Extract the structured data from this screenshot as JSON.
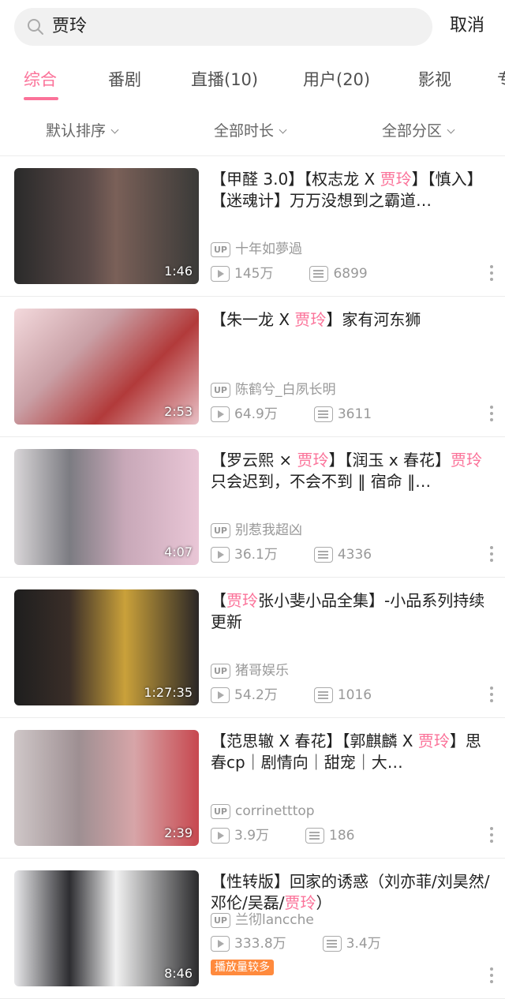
{
  "search": {
    "query": "贾玲",
    "cancel_label": "取消"
  },
  "tabs": [
    {
      "label": "综合",
      "active": true
    },
    {
      "label": "番剧"
    },
    {
      "label": "直播(10)"
    },
    {
      "label": "用户(20)"
    },
    {
      "label": "影视"
    },
    {
      "label": "专"
    }
  ],
  "filters": [
    {
      "label": "默认排序"
    },
    {
      "label": "全部时长"
    },
    {
      "label": "全部分区"
    }
  ],
  "colors": {
    "accent": "#fb7299",
    "hot_badge": "#ff8a3d"
  },
  "videos": [
    {
      "title_parts": [
        {
          "text": "【甲醛 3.0】【权志龙 X "
        },
        {
          "text": "贾玲",
          "hl": true
        },
        {
          "text": "】【慎入】【迷魂计】万万没想到之霸道…"
        }
      ],
      "duration": "1:46",
      "uploader": "十年如夢過",
      "views": "145万",
      "danmaku": "6899"
    },
    {
      "title_parts": [
        {
          "text": "【朱一龙 X "
        },
        {
          "text": "贾玲",
          "hl": true
        },
        {
          "text": "】家有河东狮"
        }
      ],
      "duration": "2:53",
      "uploader": "陈鹤兮_白夙长明",
      "views": "64.9万",
      "danmaku": "3611"
    },
    {
      "title_parts": [
        {
          "text": "【罗云熙 × "
        },
        {
          "text": "贾玲",
          "hl": true
        },
        {
          "text": "】【润玉 x 春花】"
        },
        {
          "text": "贾玲",
          "hl": true
        },
        {
          "text": "只会迟到，不会不到 ‖ 宿命 ‖…"
        }
      ],
      "duration": "4:07",
      "uploader": "别惹我超凶",
      "views": "36.1万",
      "danmaku": "4336"
    },
    {
      "title_parts": [
        {
          "text": "【"
        },
        {
          "text": "贾玲",
          "hl": true
        },
        {
          "text": "张小斐小品全集】-小品系列持续更新"
        }
      ],
      "duration": "1:27:35",
      "uploader": "猪哥娱乐",
      "views": "54.2万",
      "danmaku": "1016"
    },
    {
      "title_parts": [
        {
          "text": "【范思辙 X 春花】【郭麒麟 X "
        },
        {
          "text": "贾玲",
          "hl": true
        },
        {
          "text": "】思春cp｜剧情向｜甜宠｜大…"
        }
      ],
      "duration": "2:39",
      "uploader": "corrinetttop",
      "views": "3.9万",
      "danmaku": "186"
    },
    {
      "title_parts": [
        {
          "text": "【性转版】回家的诱惑（刘亦菲/刘昊然/邓伦/吴磊/"
        },
        {
          "text": "贾玲",
          "hl": true
        },
        {
          "text": "）"
        }
      ],
      "duration": "8:46",
      "uploader": "兰彻lancche",
      "views": "333.8万",
      "danmaku": "3.4万",
      "badge": "播放量较多"
    }
  ],
  "up_label": "UP"
}
